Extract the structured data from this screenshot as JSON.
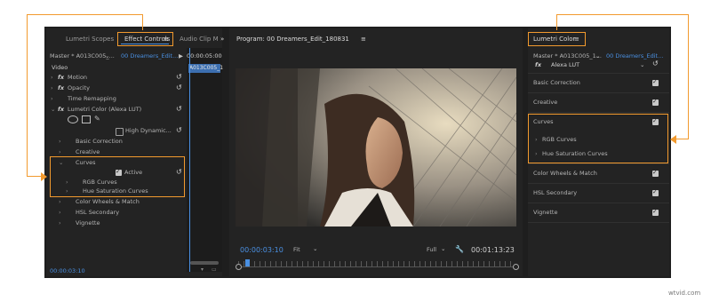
{
  "effect_controls": {
    "tabs": [
      "Lumetri Scopes",
      "Effect Controls",
      "Audio Clip M"
    ],
    "menu_glyph": "≡",
    "overflow_glyph": "»",
    "source_master": "Master * A013C005_...",
    "source_clip": "00 Dreamers_Edit...",
    "timecode_head": "00:00:05:00",
    "clip_bar": "A013C005_1",
    "section": "Video",
    "motion": "Motion",
    "opacity": "Opacity",
    "time_remapping": "Time Remapping",
    "lumetri": "Lumetri Color (Alexa LUT)",
    "high_dynamic": "High Dynamic...",
    "basic_correction": "Basic Correction",
    "creative": "Creative",
    "curves": "Curves",
    "active": "Active",
    "rgb_curves": "RGB Curves",
    "hue_sat": "Hue Saturation Curves",
    "color_wheels": "Color Wheels & Match",
    "hsl": "HSL Secondary",
    "vignette": "Vignette",
    "timecode": "00:00:03:10"
  },
  "program": {
    "title": "Program: 00 Dreamers_Edit_180831",
    "menu_glyph": "≡",
    "timecode": "00:00:03:10",
    "fit": "Fit",
    "quality": "Full",
    "duration": "00:01:13:23"
  },
  "lumetri_color": {
    "title": "Lumetri Color",
    "menu_glyph": "≡",
    "source_master": "Master * A013C005_1...",
    "source_clip": "00 Dreamers_Edit...",
    "fx_label": "fx",
    "lut": "Alexa LUT",
    "sections": [
      "Basic Correction",
      "Creative",
      "Curves",
      "Color Wheels & Match",
      "HSL Secondary",
      "Vignette"
    ],
    "rgb_curves": "RGB Curves",
    "hue_sat": "Hue Saturation Curves"
  },
  "watermark": "wtvid.com",
  "colors": {
    "accent": "#f29a2e",
    "blue": "#4a90e2"
  }
}
